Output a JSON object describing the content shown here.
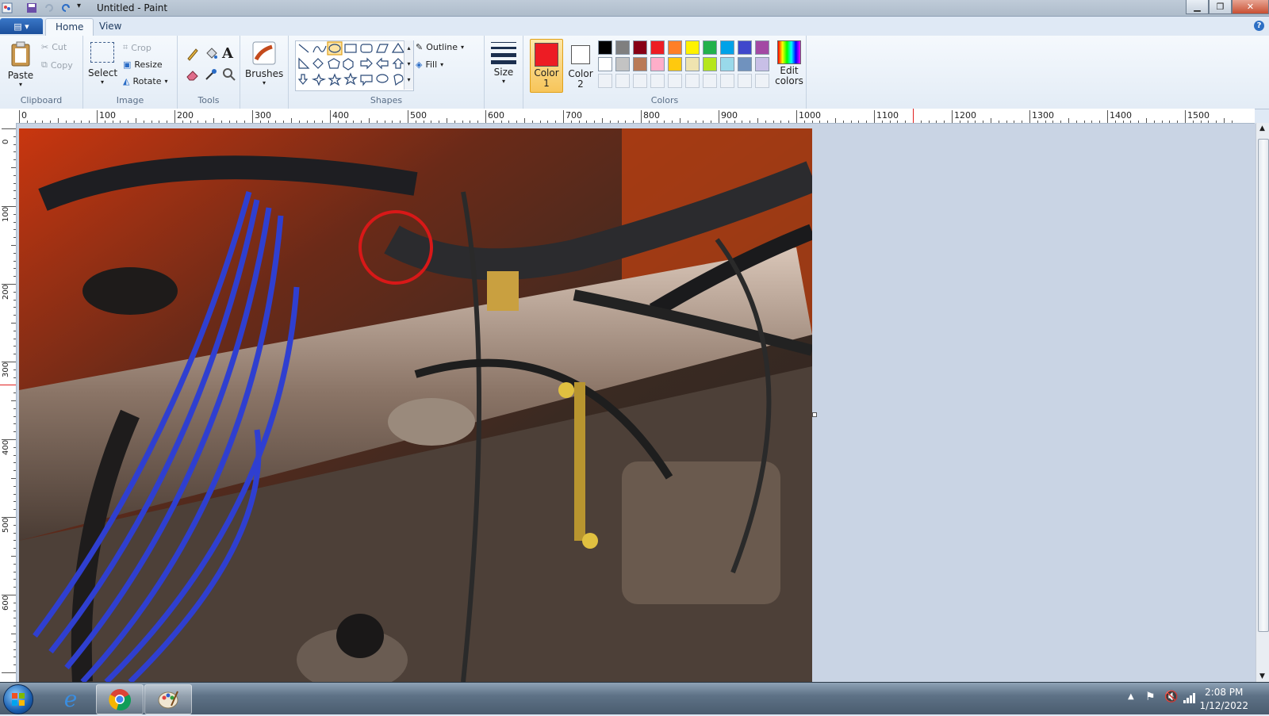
{
  "window": {
    "title": "Untitled - Paint"
  },
  "tabs": [
    {
      "label": "Home",
      "active": true
    },
    {
      "label": "View",
      "active": false
    }
  ],
  "clipboard": {
    "paste": "Paste",
    "cut": "Cut",
    "copy": "Copy",
    "group": "Clipboard"
  },
  "image": {
    "select": "Select",
    "crop": "Crop",
    "resize": "Resize",
    "rotate": "Rotate",
    "group": "Image"
  },
  "tools": {
    "group": "Tools"
  },
  "brushes": {
    "label": "Brushes"
  },
  "shapes": {
    "outline": "Outline",
    "fill": "Fill",
    "group": "Shapes"
  },
  "size": {
    "label": "Size"
  },
  "colors": {
    "color1": "Color\n1",
    "color1_a": "Color",
    "color1_b": "1",
    "color2_a": "Color",
    "color2_b": "2",
    "edit_a": "Edit",
    "edit_b": "colors",
    "group": "Colors",
    "color1_value": "#ed1c24",
    "color2_value": "#ffffff",
    "row1": [
      "#000000",
      "#7f7f7f",
      "#880015",
      "#ed1c24",
      "#ff7f27",
      "#fff200",
      "#22b14c",
      "#00a2e8",
      "#3f48cc",
      "#a349a4"
    ],
    "row2": [
      "#ffffff",
      "#c3c3c3",
      "#b97a57",
      "#ffaec9",
      "#ffc90e",
      "#efe4b0",
      "#b5e61d",
      "#99d9ea",
      "#7092be",
      "#c8bfe7"
    ]
  },
  "ruler": {
    "h": [
      "0",
      "100",
      "200",
      "300",
      "400",
      "500",
      "600",
      "700",
      "800",
      "900",
      "1000",
      "1100",
      "1200",
      "1300",
      "1400",
      "1500"
    ],
    "v": [
      "0",
      "100",
      "200",
      "300",
      "400",
      "500",
      "600"
    ]
  },
  "taskbar": {
    "time": "2:08 PM",
    "date": "1/12/2022"
  }
}
